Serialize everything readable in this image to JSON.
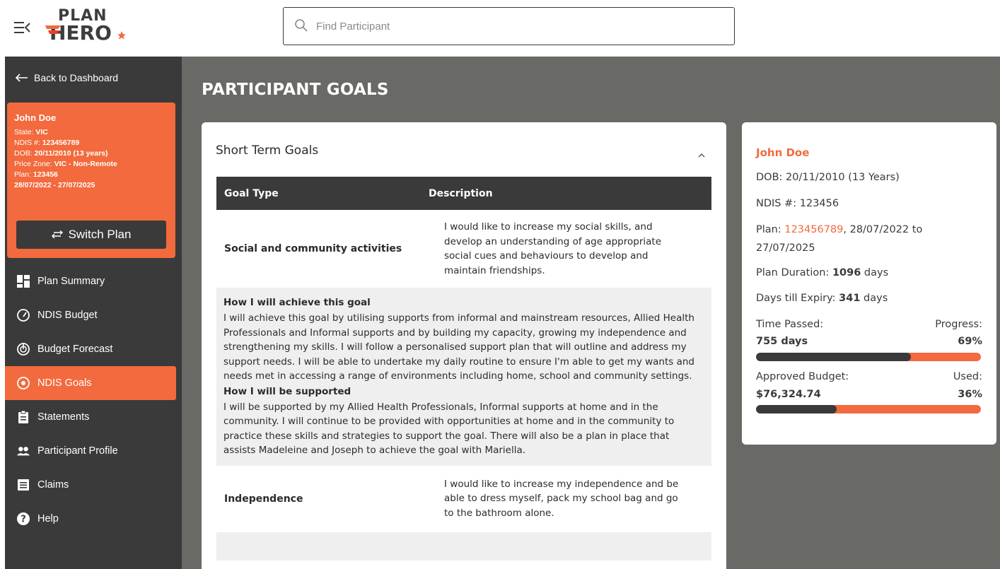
{
  "header": {
    "logo_top": "PLAN",
    "logo_bottom": "HERO",
    "search_placeholder": "Find Participant"
  },
  "sidebar": {
    "back_label": "Back to Dashboard",
    "participant": {
      "name": "John Doe",
      "state_label": "State: ",
      "state": "VIC",
      "ndis_label": "NDIS #: ",
      "ndis": "123456789",
      "dob_label": "DOB: ",
      "dob": "20/11/2010  (13 years)",
      "price_zone_label": "Price Zone: ",
      "price_zone": "VIC - Non-Remote",
      "plan_label": "Plan: ",
      "plan": "123456",
      "plan_dates": "28/07/2022 - 27/07/2025"
    },
    "switch_plan_label": "Switch Plan",
    "nav": [
      {
        "label": "Plan Summary",
        "icon": "dashboard-icon"
      },
      {
        "label": "NDIS Budget",
        "icon": "gauge-icon"
      },
      {
        "label": "Budget Forecast",
        "icon": "forecast-icon"
      },
      {
        "label": "NDIS Goals",
        "icon": "target-icon",
        "active": true
      },
      {
        "label": "Statements",
        "icon": "clipboard-icon"
      },
      {
        "label": "Participant Profile",
        "icon": "people-icon"
      },
      {
        "label": "Claims",
        "icon": "document-icon"
      },
      {
        "label": "Help",
        "icon": "help-icon"
      }
    ]
  },
  "main": {
    "page_title": "PARTICIPANT GOALS",
    "section_title": "Short Term Goals",
    "columns": [
      "Goal Type",
      "Description"
    ],
    "goals": [
      {
        "type": "Social and community activities",
        "description": "I would like to increase my social skills, and develop an understanding of age appropriate social cues and behaviours to develop and maintain friendships.",
        "achieve_heading": "How I will achieve this goal",
        "achieve_text": "I will achieve this goal by utilising supports from informal and mainstream resources, Allied Health Professionals and Informal supports and by building my capacity, growing my independence and strengthening my skills. I will follow a personalised support plan that will outline and address my support needs. I will be able to undertake my daily routine to ensure I'm able to get my wants and needs met in accessing a range of environments including home, school and community settings.",
        "support_heading": "How I will be supported",
        "support_text": "I will be supported by my Allied Health Professionals, Informal supports at home and in the community. I will continue to be provided with opportunities at home and in the community to practice these skills and strategies to support the goal. There will also be a plan in place that assists Madeleine and Joseph to achieve the goal with Mariella."
      },
      {
        "type": "Independence",
        "description": "I would like to increase my independence and be able to dress myself, pack my school bag and go to the bathroom alone."
      }
    ]
  },
  "info_card": {
    "name": "John Doe",
    "dob": "DOB: 20/11/2010  (13 Years)",
    "ndis": "NDIS #: 123456",
    "plan_label": "Plan: ",
    "plan_number": "123456789",
    "plan_dates_a": ", 28/07/2022 to",
    "plan_dates_b": "27/07/2025",
    "duration_label": "Plan Duration: ",
    "duration_value": "1096",
    "duration_unit": " days",
    "expiry_label": "Days till Expiry: ",
    "expiry_value": "341",
    "expiry_unit": " days",
    "time_passed_label": "Time Passed:",
    "time_passed_value": "755 days",
    "progress_label": "Progress:",
    "progress_value": "69%",
    "progress_fraction": 0.69,
    "budget_label": "Approved Budget:",
    "budget_value": "$76,324.74",
    "used_label": "Used:",
    "used_value": "36%",
    "used_fraction": 0.36
  },
  "colors": {
    "accent": "#f26a3d",
    "dark": "#3a3a3a",
    "main_bg": "#696965",
    "detail_bg": "#efefef"
  }
}
